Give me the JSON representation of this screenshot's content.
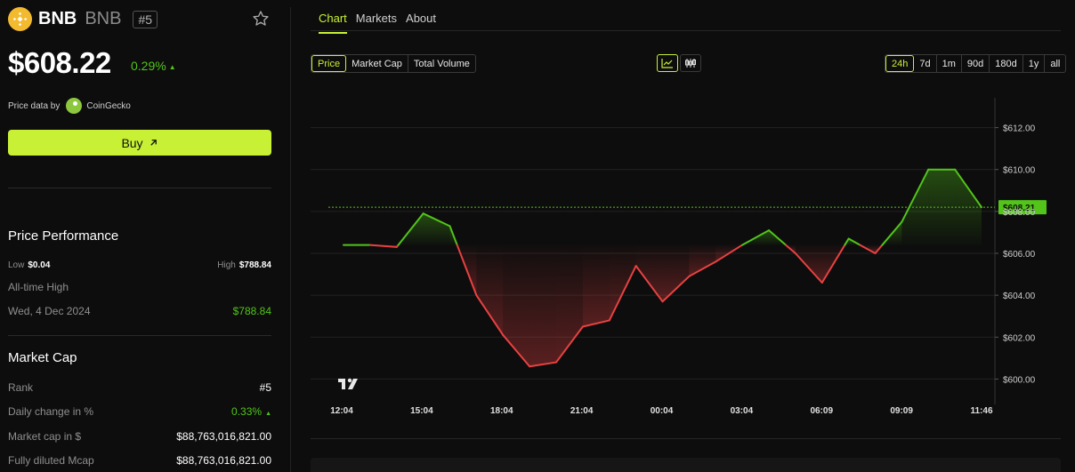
{
  "coin": {
    "name": "BNB",
    "symbol": "BNB",
    "rank_badge": "#5",
    "price": "$608.22",
    "change": "0.29%",
    "price_source_label": "Price data by",
    "price_source": "CoinGecko",
    "buy_label": "Buy",
    "colors": {
      "accent": "#c8f135",
      "up": "#52c41a",
      "down": "#e84142",
      "logo": "#f3ba2f"
    }
  },
  "performance": {
    "title": "Price Performance",
    "low_label": "Low",
    "low_value": "$0.04",
    "high_label": "High",
    "high_value": "$788.84",
    "ath_label": "All-time High",
    "ath_date": "Wed, 4 Dec 2024",
    "ath_value": "$788.84"
  },
  "market_cap": {
    "title": "Market Cap",
    "rows": [
      {
        "label": "Rank",
        "value": "#5"
      },
      {
        "label": "Daily change in %",
        "value": "0.33%"
      },
      {
        "label": "Market cap in $",
        "value": "$88,763,016,821.00"
      },
      {
        "label": "Fully diluted Mcap",
        "value": "$88,763,016,821.00"
      }
    ]
  },
  "tabs": [
    "Chart",
    "Markets",
    "About"
  ],
  "metric_buttons": [
    "Price",
    "Market Cap",
    "Total Volume"
  ],
  "range_buttons": [
    "24h",
    "7d",
    "1m",
    "90d",
    "180d",
    "1y",
    "all"
  ],
  "view_icons": [
    "line-chart-icon",
    "candlestick-icon"
  ],
  "chart_data": {
    "type": "line",
    "x": [
      "12:04",
      "12:40",
      "13:40",
      "14:40",
      "15:40",
      "16:40",
      "17:40",
      "18:40",
      "19:40",
      "20:40",
      "21:40",
      "22:40",
      "23:40",
      "00:40",
      "01:40",
      "02:40",
      "03:40",
      "04:40",
      "05:40",
      "06:40",
      "07:40",
      "08:40",
      "09:40",
      "10:40",
      "11:40",
      "11:46"
    ],
    "values": [
      606.4,
      606.4,
      606.3,
      607.9,
      607.3,
      604.0,
      602.1,
      600.6,
      600.8,
      602.5,
      602.8,
      605.4,
      603.7,
      604.9,
      605.6,
      606.4,
      607.1,
      606.0,
      604.6,
      606.7,
      606.0,
      607.5,
      610.0,
      610.0,
      608.2
    ],
    "baseline": 606.4,
    "current_label": "$608.21",
    "ylim": [
      599.0,
      613.0
    ],
    "yticks": [
      600,
      602,
      604,
      606,
      608,
      610,
      612
    ],
    "ytick_labels": [
      "$600.00",
      "$602.00",
      "$604.00",
      "$606.00",
      "$608.00",
      "$610.00",
      "$612.00"
    ],
    "xtick_labels": [
      "12:04",
      "15:04",
      "18:04",
      "21:04",
      "00:04",
      "03:04",
      "06:09",
      "09:09",
      "11:46"
    ],
    "grid": true
  }
}
